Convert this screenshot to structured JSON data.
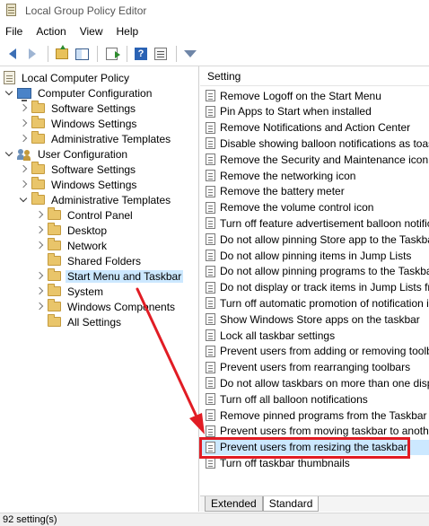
{
  "window": {
    "title": "Local Group Policy Editor"
  },
  "menu": [
    "File",
    "Action",
    "View",
    "Help"
  ],
  "toolbar": {
    "buttons": [
      "back-icon",
      "forward-icon",
      "up-one-level-icon",
      "show-hide-tree-icon",
      "export-list-icon",
      "help-icon",
      "properties-icon",
      "filter-icon"
    ]
  },
  "tree": {
    "root": "Local Computer Policy",
    "computer_config": "Computer Configuration",
    "cc_software": "Software Settings",
    "cc_windows": "Windows Settings",
    "cc_admin": "Administrative Templates",
    "user_config": "User Configuration",
    "uc_software": "Software Settings",
    "uc_windows": "Windows Settings",
    "uc_admin": "Administrative Templates",
    "control_panel": "Control Panel",
    "desktop": "Desktop",
    "network": "Network",
    "shared_folders": "Shared Folders",
    "start_menu": "Start Menu and Taskbar",
    "system": "System",
    "windows_components": "Windows Components",
    "all_settings": "All Settings"
  },
  "list": {
    "header": "Setting",
    "items": [
      "Remove Logoff on the Start Menu",
      "Pin Apps to Start when installed",
      "Remove Notifications and Action Center",
      "Disable showing balloon notifications as toasts.",
      "Remove the Security and Maintenance icon",
      "Remove the networking icon",
      "Remove the battery meter",
      "Remove the volume control icon",
      "Turn off feature advertisement balloon notificat",
      "Do not allow pinning Store app to the Taskbar",
      "Do not allow pinning items in Jump Lists",
      "Do not allow pinning programs to the Taskbar",
      "Do not display or track items in Jump Lists from",
      "Turn off automatic promotion of notification ic",
      "Show Windows Store apps on the taskbar",
      "Lock all taskbar settings",
      "Prevent users from adding or removing toolbar",
      "Prevent users from rearranging toolbars",
      "Do not allow taskbars on more than one display",
      "Turn off all balloon notifications",
      "Remove pinned programs from the Taskbar",
      "Prevent users from moving taskbar to another s",
      "Prevent users from resizing the taskbar",
      "Turn off taskbar thumbnails"
    ]
  },
  "tabs": [
    "Extended",
    "Standard"
  ],
  "status": "92 setting(s)",
  "colors": {
    "highlight": "#e11c24",
    "selection": "#cce8ff"
  }
}
